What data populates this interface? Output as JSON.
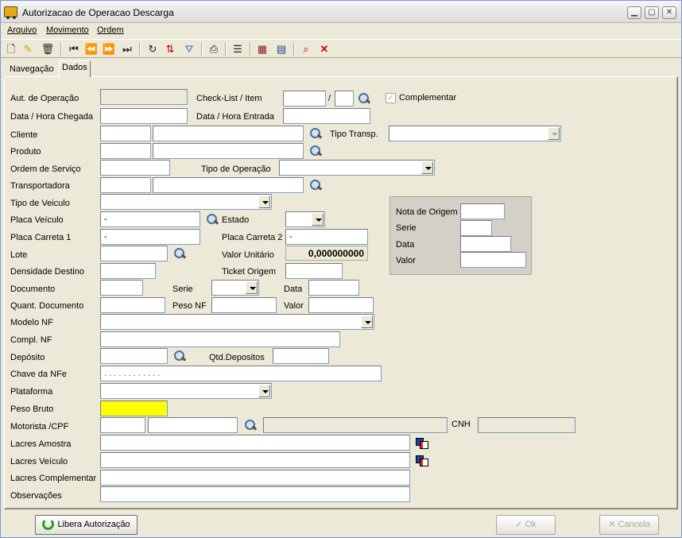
{
  "window": {
    "title": "Autorizacao de Operacao Descarga",
    "min": "▁",
    "max": "▢",
    "close": "✕"
  },
  "menu": {
    "arquivo": "Arquivo",
    "movimento": "Movimento",
    "ordem": "Ordem"
  },
  "toolbar": {
    "icons": [
      "new-document-icon",
      "edit-icon",
      "delete-icon",
      "first-record-icon",
      "prior-record-icon",
      "next-record-icon",
      "last-record-icon",
      "refresh-icon",
      "sort-icon",
      "filter-icon",
      "print-icon",
      "properties-icon",
      "calendar-icon",
      "grid-icon",
      "search-record-icon",
      "cancel-icon"
    ]
  },
  "tabs": {
    "navegacao": "Navegação",
    "dados": "Dados"
  },
  "labels": {
    "aut_operacao": "Aut. de Operação",
    "checklist_item": "Check-List / Item",
    "slash": "/",
    "complementar": "Complementar",
    "data_hora_chegada": "Data / Hora Chegada",
    "data_hora_entrada": "Data / Hora Entrada",
    "cliente": "Cliente",
    "tipo_transp": "Tipo Transp.",
    "produto": "Produto",
    "ordem_servico": "Ordem de Serviço",
    "tipo_operacao": "Tipo de Operação",
    "transportadora": "Transportadora",
    "tipo_veiculo": "Tipo de Veiculo",
    "placa_veiculo": "Placa Veículo",
    "estado": "Estado",
    "placa_carreta1": "Placa Carreta 1",
    "placa_carreta2": "Placa Carreta 2",
    "lote": "Lote",
    "valor_unitario": "Valor Unitário",
    "densidade_destino": "Densidade  Destino",
    "ticket_origem": "Ticket Origem",
    "documento": "Documento",
    "serie": "Serie",
    "data": "Data",
    "quant_documento": "Quant. Documento",
    "peso_nf": "Peso NF",
    "valor": "Valor",
    "modelo_nf": "Modelo NF",
    "compl_nf": "Compl. NF",
    "deposito": "Depósito",
    "qtd_depositos": "Qtd.Depositos",
    "chave_nfe": "Chave da NFe",
    "plataforma": "Plataforma",
    "peso_bruto": "Peso Bruto",
    "motorista_cpf": "Motorista /CPF",
    "cnh": "CNH",
    "lacres_amostra": "Lacres Amostra",
    "lacres_veiculo": "Lacres Veículo",
    "lacres_complementar": "Lacres Complementar",
    "observacoes": "Observações"
  },
  "origem_box": {
    "nota_origem": "Nota de Origem",
    "serie": "Serie",
    "data": "Data",
    "valor": "Valor"
  },
  "values": {
    "placa_veiculo": "-",
    "placa_carreta1": "-",
    "placa_carreta2": "-",
    "valor_unitario": "0,000000000",
    "chave_nfe": ". . . . . . . . . . . .",
    "complementar_checked": "✓"
  },
  "buttons": {
    "libera": "Libera Autorização",
    "ok": "Ok",
    "cancela": "Cancela"
  },
  "colors": {
    "peso_bruto_highlight": "#ffff00",
    "window_bg": "#ece9d8"
  }
}
